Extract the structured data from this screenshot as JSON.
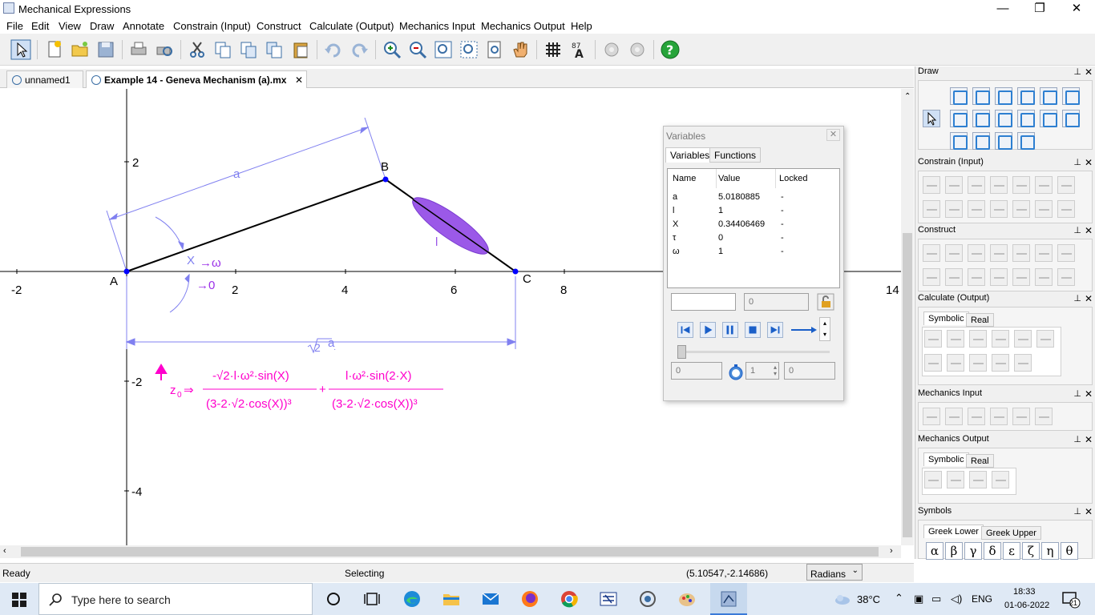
{
  "window": {
    "title": "Mechanical Expressions",
    "minimize": "—",
    "restore": "❐",
    "close": "✕"
  },
  "menu": [
    "File",
    "Edit",
    "View",
    "Draw",
    "Annotate",
    "Constrain (Input)",
    "Construct",
    "Calculate (Output)",
    "Mechanics Input",
    "Mechanics Output",
    "Help"
  ],
  "tabs": [
    {
      "label": "unnamed1"
    },
    {
      "label": "Example 14 - Geneva Mechanism (a).mx"
    }
  ],
  "tab_close": "✕",
  "canvas": {
    "x_ticks": [
      "-2",
      "2",
      "4",
      "6",
      "8",
      "14"
    ],
    "y_ticks": [
      "2",
      "-2",
      "-4"
    ],
    "points": {
      "A": "A",
      "B": "B",
      "C": "C"
    },
    "labels": {
      "a": "a",
      "l": "l",
      "x": "X",
      "arrow_omega": "→ω",
      "arrow_zero": "→0",
      "sqrt2a": "a"
    },
    "formula": {
      "lhs": "z",
      "lhs_sub": "0",
      "arrow": "⇒",
      "num1": "-√2·l·ω²·sin(X)",
      "den1": "(3-2·√2·cos(X))³",
      "plus": "+",
      "num2": "l·ω²·sin(2·X)",
      "den2": "(3-2·√2·cos(X))³"
    }
  },
  "variables_window": {
    "title": "Variables",
    "close": "✕",
    "tabs": [
      "Variables",
      "Functions"
    ],
    "columns": [
      "Name",
      "Value",
      "Locked"
    ],
    "rows": [
      {
        "name": "a",
        "value": "5.0180885",
        "locked": "-"
      },
      {
        "name": "l",
        "value": "1",
        "locked": "-"
      },
      {
        "name": "X",
        "value": "0.34406469",
        "locked": "-"
      },
      {
        "name": "τ",
        "value": "0",
        "locked": "-"
      },
      {
        "name": "ω",
        "value": "1",
        "locked": "-"
      }
    ],
    "value_field": "0",
    "start_field": "0",
    "step_field": "1",
    "end_field": "0"
  },
  "panel": {
    "sections": {
      "draw": "Draw",
      "constrain": "Constrain (Input)",
      "construct": "Construct",
      "calculate": "Calculate (Output)",
      "mech_input": "Mechanics Input",
      "mech_output": "Mechanics Output",
      "symbols": "Symbols"
    },
    "pin": "⊥",
    "close": "✕",
    "calc_tabs": [
      "Symbolic",
      "Real"
    ],
    "mech_tabs": [
      "Symbolic",
      "Real"
    ],
    "symbol_tabs": [
      "Greek Lower",
      "Greek Upper"
    ],
    "greek": [
      "α",
      "β",
      "γ",
      "δ",
      "ε",
      "ζ",
      "η",
      "θ"
    ]
  },
  "status": {
    "left": "Ready",
    "mode": "Selecting",
    "coords": "(5.10547,-2.14686)",
    "angle_unit": "Radians"
  },
  "taskbar": {
    "search_placeholder": "Type here to search",
    "temperature": "38°C",
    "language": "ENG",
    "time": "18:33",
    "date": "01-06-2022",
    "notifications": "21"
  }
}
